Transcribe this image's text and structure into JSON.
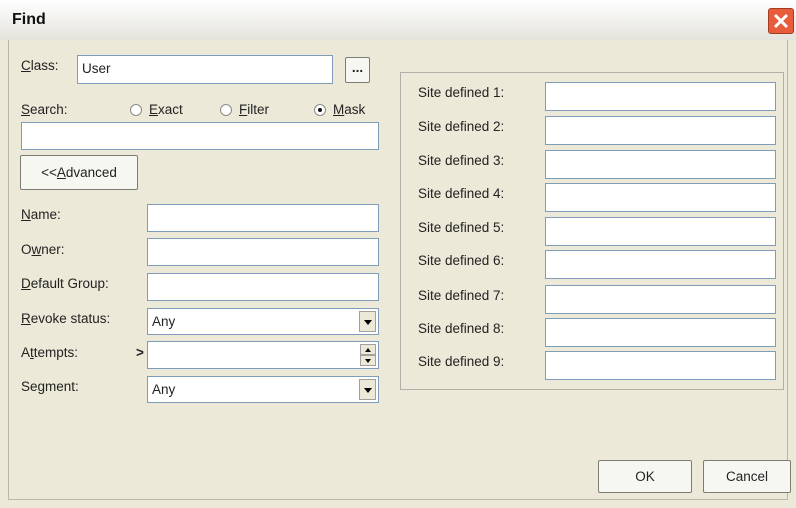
{
  "window": {
    "title": "Find"
  },
  "class": {
    "label": "Class:",
    "accel": "C",
    "rest": "lass:",
    "value": "User",
    "browse_label": "..."
  },
  "search": {
    "label_accel": "S",
    "label_rest": "earch:",
    "value": "",
    "options": [
      {
        "accel": "E",
        "rest": "xact",
        "selected": false
      },
      {
        "accel": "F",
        "rest": "ilter",
        "selected": false
      },
      {
        "accel": "M",
        "rest": "ask",
        "selected": true
      }
    ]
  },
  "advanced": {
    "prefix": "<<",
    "accel": "A",
    "rest": "dvanced"
  },
  "fields": {
    "name": {
      "pre": "",
      "accel": "N",
      "rest": "ame:",
      "value": ""
    },
    "owner": {
      "pre": "O",
      "accel": "w",
      "rest": "ner:",
      "value": ""
    },
    "default_group": {
      "pre": "",
      "accel": "D",
      "rest": "efault Group:",
      "value": ""
    },
    "revoke_status": {
      "pre": "",
      "accel": "R",
      "rest": "evoke status:",
      "value": "Any"
    },
    "attempts": {
      "pre": "A",
      "accel": "t",
      "rest": "tempts:",
      "operator": ">",
      "value": ""
    },
    "segment": {
      "pre": "Se",
      "accel": "g",
      "rest": "ment:",
      "value": "Any"
    }
  },
  "site_defined": [
    {
      "label": "Site defined 1:",
      "value": ""
    },
    {
      "label": "Site defined 2:",
      "value": ""
    },
    {
      "label": "Site defined 3:",
      "value": ""
    },
    {
      "label": "Site defined 4:",
      "value": ""
    },
    {
      "label": "Site defined 5:",
      "value": ""
    },
    {
      "label": "Site defined 6:",
      "value": ""
    },
    {
      "label": "Site defined 7:",
      "value": ""
    },
    {
      "label": "Site defined 8:",
      "value": ""
    },
    {
      "label": "Site defined 9:",
      "value": ""
    }
  ],
  "buttons": {
    "ok": "OK",
    "cancel": "Cancel"
  },
  "icons": {
    "close": "close-icon",
    "dropdown": "chevron-down-icon",
    "spin_up": "spin-up-icon",
    "spin_down": "spin-down-icon"
  },
  "colors": {
    "close_button": "#e85c3c",
    "field_border": "#7f9db9",
    "dialog_bg": "#ece9d8"
  }
}
